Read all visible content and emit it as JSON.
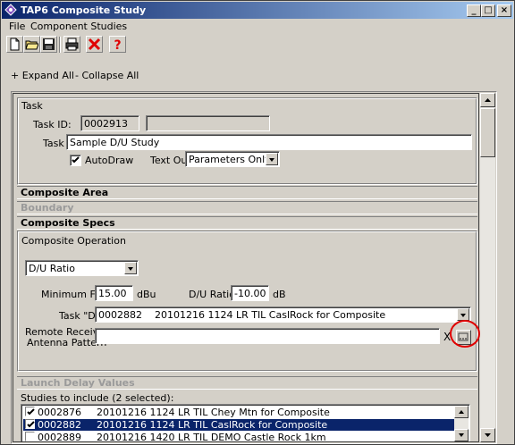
{
  "window": {
    "title": "TAP6 Composite Study"
  },
  "menu": {
    "file": "File",
    "component_studies": "Component Studies"
  },
  "actions": {
    "expand_all": "+ Expand All",
    "collapse_all": "- Collapse All"
  },
  "task": {
    "group_label": "Task",
    "id_label": "Task ID:",
    "id_value": "0002913",
    "name_label": "Task",
    "name_value": "Sample D/U Study",
    "autodraw_label": "AutoDraw",
    "autodraw_checked": true,
    "textout_label": "Text Out:",
    "textout_value": "Parameters Only"
  },
  "sections": {
    "composite_area": "Composite Area",
    "boundary": "Boundary",
    "composite_specs": "Composite Specs",
    "launch_delay": "Launch Delay Values"
  },
  "composite_specs": {
    "operation_label": "Composite Operation",
    "operation_value": "D/U Ratio",
    "min_field_label": "Minimum Field",
    "min_field_value": "15.00",
    "min_field_unit": "dBu",
    "du_ratio_label": "D/U Ratio",
    "du_ratio_value": "-10.00",
    "du_ratio_unit": "dB",
    "task_d_label": "Task \"D\"",
    "task_d_value": "0002882    20101216 1124 LR TIL CaslRock for Composite",
    "rx_pattern_label_1": "Remote Receiver",
    "rx_pattern_label_2": "Antenna Pattern",
    "rx_pattern_value": "",
    "clear_label": "X"
  },
  "studies": {
    "label": "Studies to include (2 selected):",
    "rows": [
      {
        "id": "0002876",
        "desc": "20101216 1124 LR TIL Chey Mtn for Composite",
        "checked": true
      },
      {
        "id": "0002882",
        "desc": "20101216 1124 LR TIL CaslRock for Composite",
        "checked": true
      },
      {
        "id": "0002889",
        "desc": "20101216 1420 LR TIL DEMO Castle Rock 1km",
        "checked": false
      }
    ]
  },
  "colors": {
    "title_bar": "#0a246a",
    "selection": "#0a246a",
    "highlight_circle": "#e00000"
  }
}
